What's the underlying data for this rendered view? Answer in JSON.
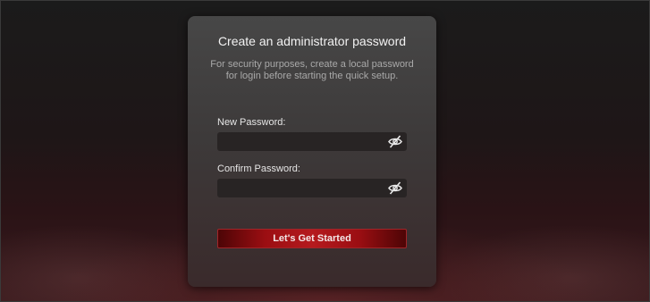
{
  "dialog": {
    "title": "Create an administrator password",
    "description": "For security purposes, create a local password for login before starting the quick setup.",
    "new_password": {
      "label": "New Password:",
      "value": "",
      "toggle_icon": "eye-slash-icon"
    },
    "confirm_password": {
      "label": "Confirm Password:",
      "value": "",
      "toggle_icon": "eye-slash-icon"
    },
    "submit_label": "Let's Get Started"
  },
  "colors": {
    "accent": "#b51a1e",
    "card_top": "#474747",
    "field_bg": "#282424"
  }
}
